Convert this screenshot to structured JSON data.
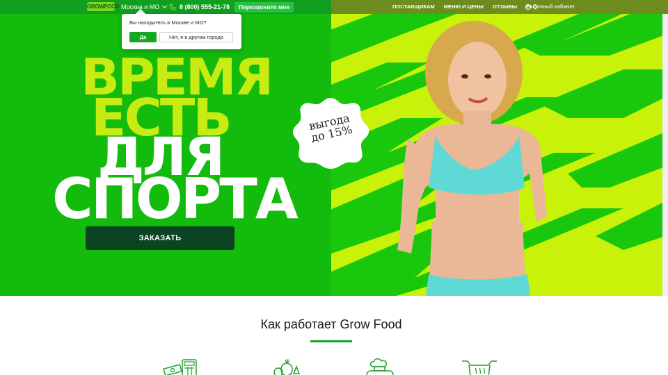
{
  "header": {
    "logo": "GROWFOOD",
    "city": "Москва и МО",
    "phone": "8 (800) 555-21-78",
    "callback": "Перезвоните мне",
    "nav": [
      "ПОСТАВЩИКАМ",
      "МЕНЮ И ЦЕНЫ",
      "ОТЗЫВЫ",
      "FAQ"
    ],
    "account": "Личный кабинет"
  },
  "popup": {
    "question": "Вы находитесь в Москве и МО?",
    "yes": "Да",
    "no": "Нет, я в другом городе"
  },
  "hero": {
    "line1": "ВРЕМЯ",
    "line2": "ЕСТЬ",
    "line3": "ДЛЯ",
    "line4": "СПОРТА",
    "order_button": "ЗАКАЗАТЬ",
    "badge_line1": "выгода",
    "badge_line2": "до 15%"
  },
  "how": {
    "title": "Как работает Grow Food",
    "icons": [
      "calculator-money-icon",
      "vegetables-icon",
      "chef-icon",
      "cooking-pot-icon"
    ]
  },
  "colors": {
    "hero_left": "#13bb0c",
    "hero_right": "#c8f20a",
    "headline_lime": "#c6ec13",
    "order_button": "#0c4423",
    "accent_green": "#13a51e"
  }
}
